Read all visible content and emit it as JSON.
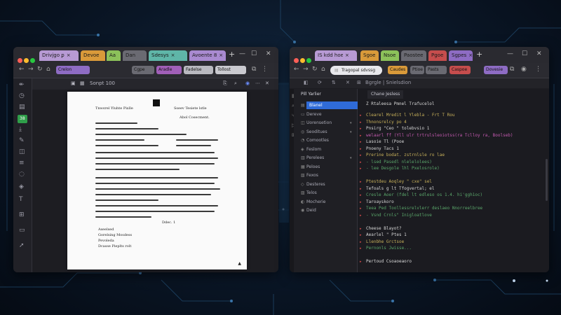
{
  "left_window": {
    "tabs": [
      {
        "label": "Drivjgo ꝑ",
        "color": "#b79ad4"
      },
      {
        "label": "Devoe",
        "color": "#d99a3a"
      },
      {
        "label": "Aa",
        "color": "#8cc15a"
      },
      {
        "label": "Dan",
        "color": "#6a6a72"
      },
      {
        "label": "Sdesys",
        "color": "#5fb6a8"
      },
      {
        "label": "Avoente 8",
        "color": "#a98ad0"
      }
    ],
    "nav_chips": [
      {
        "label": "Crelon",
        "color": "#8e6cc4"
      },
      {
        "label": "Cgpe",
        "color": "#6a6a72"
      },
      {
        "label": "Aradle",
        "color": "#a15fb8"
      },
      {
        "label": "Fadelse",
        "color": "#b9b9c0"
      },
      {
        "label": "Tollost",
        "color": "#c9c9cf"
      }
    ],
    "pdf_toolbar_label": "Sonpt 100",
    "sidebar_badge": "38",
    "document": {
      "heading_left": "Tnwsrel Yluhte Pixlle",
      "heading_right": "Sseev   Tesiete lstle",
      "section_right": "Abol Cosecment.",
      "body_tail": "Ddec. 1",
      "bullets": [
        "Aseelsed",
        "Gorelsing Mosdess",
        "Pevoleda",
        "Dcasse Pieplts rolt"
      ]
    }
  },
  "right_window": {
    "tabs": [
      {
        "label": "IS kdd hoe",
        "color": "#b79ad4"
      },
      {
        "label": "Sgoe",
        "color": "#d99a3a"
      },
      {
        "label": "Nsoe",
        "color": "#8cc15a"
      },
      {
        "label": "Paostee",
        "color": "#6a6a72"
      },
      {
        "label": "Pgoe",
        "color": "#c64d4d"
      },
      {
        "label": "Sgpes",
        "color": "#8e6cc4"
      }
    ],
    "url": "Tragopal sdvssg",
    "nav_chips": [
      {
        "label": "Caudes",
        "color": "#d99a3a"
      },
      {
        "label": "Ptioe",
        "color": "#6a6a72"
      },
      {
        "label": "Pasts",
        "color": "#6a6a72"
      },
      {
        "label": "Caspoe",
        "color": "#c64d4d"
      },
      {
        "label": "Dovesie",
        "color": "#8e6cc4"
      }
    ],
    "toolbar_label": "Bgrgle | Snielsdion",
    "explorer": {
      "title": "Pill Yarlier",
      "items": [
        "Blanel",
        "Dereve",
        "Uorensetion",
        "Seoditues",
        "Comootles",
        "Feslom",
        "Perelees",
        "Peloes",
        "Fexos",
        "Desteres",
        "Telos",
        "Mocherie",
        "Deid"
      ]
    },
    "editor": {
      "tab": "Chane Jesless",
      "breadcrumb": "Z  Rtaleesa   Pmnel Trafucelol",
      "code_lines": [
        {
          "text": "Clearel Mredit l Ylebla - Frt T Rou",
          "color": "#c8b15a"
        },
        {
          "text": "Thnonsrelcy po 4",
          "color": "#c8b15a"
        },
        {
          "text": "Pnsirg \"Ceo \"  tolebvsio 1",
          "color": "#d8d8d8"
        },
        {
          "text": "welaarl  ff (Yll  ulr trtrulsleoiotss(ra Tclloy  ra, Boolseb)",
          "color": "#c55ab0"
        },
        {
          "text": "Lasoie Tl (Pooe",
          "color": "#d8d8d8"
        },
        {
          "text": "Pnoeny Tacs 1",
          "color": "#d8d8d8"
        },
        {
          "text": "Prerine bodat. zstrnlsle ro lae",
          "color": "#c8b15a"
        },
        {
          "text": "- lsed Pasedl nlelelolees)",
          "color": "#5aa66a"
        },
        {
          "text": "- lee  Desgole lhl Pxelosrole)",
          "color": "#5aa66a"
        },
        {
          "text": "",
          "color": "#d8d8d8"
        },
        {
          "text": "Ptestdeu Aoqley \" cxe\" sel",
          "color": "#c8b15a"
        },
        {
          "text": "Tefoals g lt Tfogvertal; el",
          "color": "#d8d8d8"
        },
        {
          "text": "Cresle Aoer (fdel lt edleso os 1.4.  hi'ggh1oc)",
          "color": "#5aa66a"
        },
        {
          "text": "Taroayskoro",
          "color": "#d8d8d8"
        },
        {
          "text": "Teea Ped  Toollessrelvlerr deslaeo  Nnorreelbree",
          "color": "#5aa66a"
        },
        {
          "text": "- Vsnd Crnls\" Inigloatlove",
          "color": "#5aa66a"
        },
        {
          "text": "",
          "color": "#d8d8d8"
        },
        {
          "text": "Cheese Blayot?",
          "color": "#d8d8d8"
        },
        {
          "text": "Aearlel \" Ptes 1",
          "color": "#d8d8d8"
        },
        {
          "text": "Llenbhe Grctsoe",
          "color": "#c8b15a"
        },
        {
          "text": "Pernonls  Jwisse...",
          "color": "#5aa66a"
        },
        {
          "text": "",
          "color": "#d8d8d8"
        },
        {
          "text": "Pertoud Csoaoeaoro",
          "color": "#d8d8d8"
        }
      ]
    }
  }
}
